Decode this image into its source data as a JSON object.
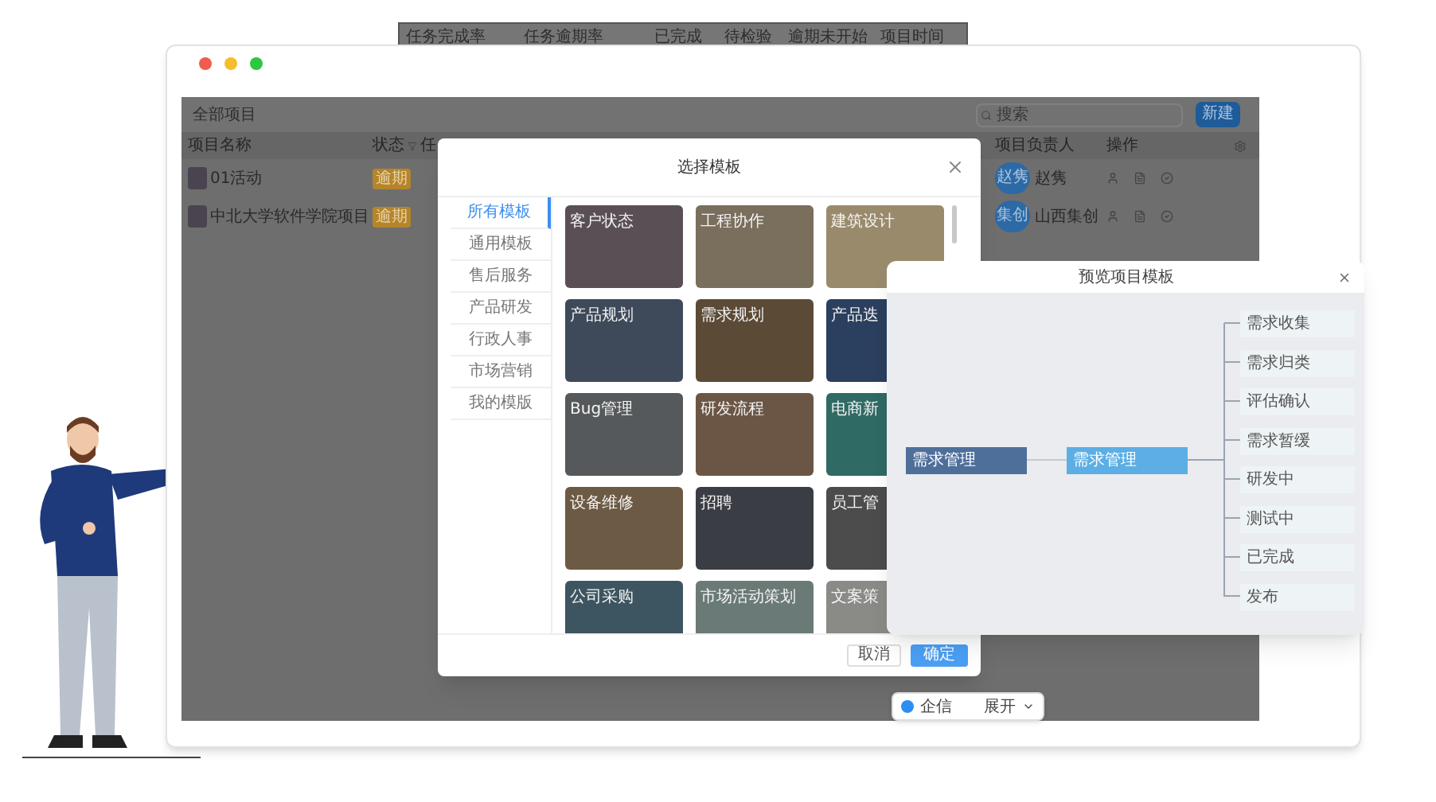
{
  "background_header": [
    "任务完成率",
    "任务逾期率",
    "已完成",
    "待检验",
    "逾期未开始",
    "项目时间"
  ],
  "window": {
    "breadcrumb": "全部项目",
    "search": {
      "placeholder": "搜索"
    },
    "new_button": "新建",
    "columns": [
      "项目名称",
      "状态",
      "任",
      "项目负责人",
      "操作"
    ],
    "rows": [
      {
        "name": "01活动",
        "status": "逾期",
        "owner_avatar": "赵隽",
        "owner": "赵隽"
      },
      {
        "name": "中北大学软件学院项目",
        "status": "逾期",
        "owner_avatar": "集创",
        "owner": "山西集创"
      }
    ]
  },
  "template_dialog": {
    "title": "选择模板",
    "categories": [
      {
        "label": "所有模板",
        "selected": true
      },
      {
        "label": "通用模板",
        "selected": false
      },
      {
        "label": "售后服务",
        "selected": false
      },
      {
        "label": "产品研发",
        "selected": false
      },
      {
        "label": "行政人事",
        "selected": false
      },
      {
        "label": "市场营销",
        "selected": false
      },
      {
        "label": "我的模版",
        "selected": false
      }
    ],
    "templates": [
      "客户状态",
      "工程协作",
      "建筑设计",
      "产品规划",
      "需求规划",
      "产品迭",
      "Bug管理",
      "研发流程",
      "电商新",
      "设备维修",
      "招聘",
      "员工管",
      "公司采购",
      "市场活动策划",
      "文案策"
    ],
    "cancel": "取消",
    "confirm": "确定"
  },
  "preview_dialog": {
    "title": "预览项目模板",
    "root": "需求管理",
    "branch": "需求管理",
    "leaves": [
      "需求收集",
      "需求归类",
      "评估确认",
      "需求暂缓",
      "研发中",
      "测试中",
      "已完成",
      "发布"
    ]
  },
  "chat_bar": {
    "label": "企信",
    "toggle": "展开"
  }
}
